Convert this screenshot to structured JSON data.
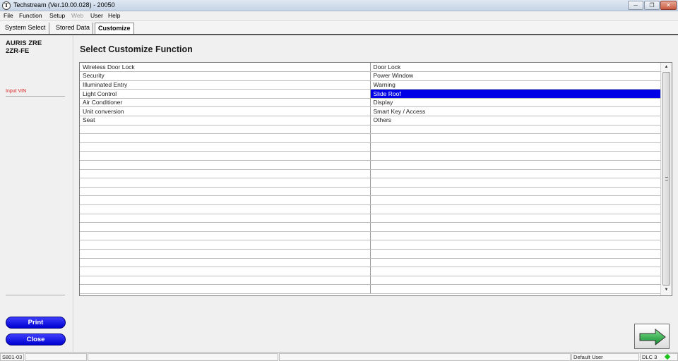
{
  "window": {
    "title": "Techstream (Ver.10.00.028) - 20050",
    "app_icon_glyph": "T",
    "minimize_glyph": "─",
    "maximize_glyph": "❐",
    "close_glyph": "✕"
  },
  "menu": [
    "File",
    "Function",
    "Setup",
    "Web",
    "User",
    "Help"
  ],
  "tabs": [
    {
      "label": "System Select",
      "active": false
    },
    {
      "label": "Stored Data",
      "active": false
    },
    {
      "label": "Customize",
      "active": true
    }
  ],
  "vehicle": {
    "model": "AURIS ZRE",
    "engine": "2ZR-FE",
    "vin_label": "Input VIN"
  },
  "buttons": {
    "print": "Print",
    "close": "Close"
  },
  "main": {
    "heading": "Select Customize Function",
    "rows": [
      [
        "Wireless Door Lock",
        "Door Lock"
      ],
      [
        "Security",
        "Power Window"
      ],
      [
        "Illuminated Entry",
        "Warning"
      ],
      [
        "Light Control",
        "Slide Roof"
      ],
      [
        "Air Conditioner",
        "Display"
      ],
      [
        "Unit conversion",
        "Smart Key / Access"
      ],
      [
        "Seat",
        "Others"
      ]
    ],
    "selected": {
      "row": 3,
      "col": 1
    },
    "total_rows": 26,
    "selection_color": "#0000e6",
    "scroll_up_glyph": "▲",
    "scroll_down_glyph": "▼"
  },
  "next_button": {
    "icon": "right-arrow-icon",
    "color": "#1fb34a"
  },
  "statusbar": {
    "code": "S801-03",
    "user": "Default User",
    "connection": "DLC 3",
    "connection_status_color": "#1bc41b"
  }
}
